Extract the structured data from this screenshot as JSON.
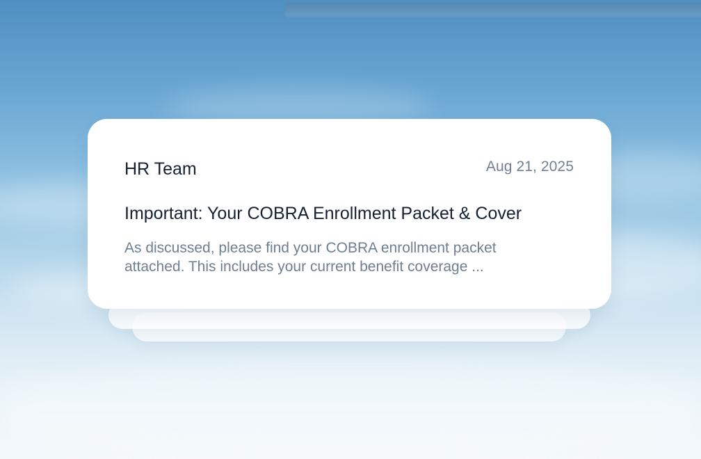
{
  "email": {
    "sender": "HR Team",
    "date": "Aug 21, 2025",
    "subject": "Important: Your COBRA Enrollment Packet & Cover",
    "preview": "As discussed, please find your COBRA enrollment packet attached. This includes your current  benefit coverage ..."
  },
  "colors": {
    "card_background": "#ffffff",
    "primary_text": "#162033",
    "secondary_text": "#6d7f91",
    "sky_top": "#4f8fc1",
    "sky_bottom": "#f3f8fb"
  }
}
